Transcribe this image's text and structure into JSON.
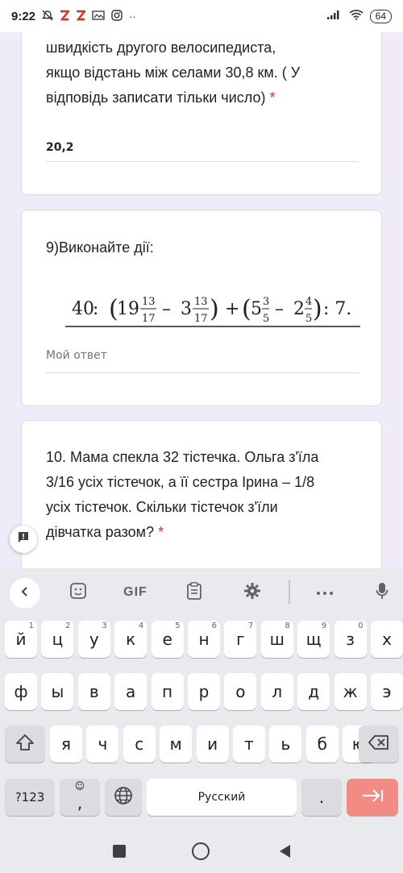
{
  "status_bar": {
    "time": "9:22",
    "battery": "64"
  },
  "q8": {
    "text_lines": [
      "швидкість другого велосипедиста,",
      "якщо відстань між селами 30,8 км. ( У",
      "відповідь записати тільки число)"
    ],
    "required_mark": "*",
    "answer": "20,2"
  },
  "q9": {
    "title": "9)Виконайте дії:",
    "expression": {
      "a": "40",
      "b": "19",
      "b_num": "13",
      "b_den": "17",
      "c": "3",
      "c_num": "13",
      "c_den": "17",
      "d": "5",
      "d_num": "3",
      "d_den": "5",
      "e": "2",
      "e_num": "4",
      "e_den": "5",
      "tail": ": 7."
    },
    "answer_placeholder": "Мой ответ"
  },
  "q10": {
    "text_lines": [
      "10. Мама спекла 32 тістечка. Ольга з'їла",
      "3/16 усіх тістечок, а її сестра Ірина – 1/8",
      "усіх тістечок. Скільки тістечок з'їли",
      "дівчатка разом?"
    ],
    "required_mark": "*"
  },
  "keyboard": {
    "toolbar": {
      "gif_label": "GIF"
    },
    "row1": [
      {
        "k": "й",
        "n": "1"
      },
      {
        "k": "ц",
        "n": "2"
      },
      {
        "k": "у",
        "n": "3"
      },
      {
        "k": "к",
        "n": "4"
      },
      {
        "k": "е",
        "n": "5"
      },
      {
        "k": "н",
        "n": "6"
      },
      {
        "k": "г",
        "n": "7"
      },
      {
        "k": "ш",
        "n": "8"
      },
      {
        "k": "щ",
        "n": "9"
      },
      {
        "k": "з",
        "n": "0"
      },
      {
        "k": "х",
        "n": ""
      }
    ],
    "row2": [
      "ф",
      "ы",
      "в",
      "а",
      "п",
      "р",
      "о",
      "л",
      "д",
      "ж",
      "э"
    ],
    "row3": [
      "я",
      "ч",
      "с",
      "м",
      "и",
      "т",
      "ь",
      "б",
      "ю"
    ],
    "symbols_label": "?123",
    "comma": ",",
    "space_label": "Русский",
    "period": "."
  }
}
